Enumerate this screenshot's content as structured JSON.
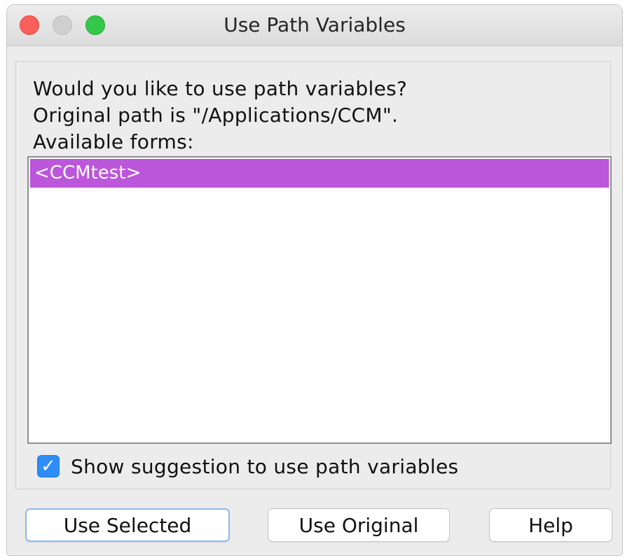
{
  "window": {
    "title": "Use Path Variables"
  },
  "message": {
    "line1": "Would you like to use path variables?",
    "line2": "Original path is \"/Applications/CCM\".",
    "line3": "Available forms:"
  },
  "forms_list": {
    "items": [
      {
        "label": "<CCMtest>",
        "selected": true
      }
    ]
  },
  "suggestion_checkbox": {
    "label": "Show suggestion to use path variables",
    "checked": true,
    "check_glyph": "✓"
  },
  "buttons": {
    "use_selected": "Use Selected",
    "use_original": "Use Original",
    "help": "Help"
  },
  "colors": {
    "selection": "#bc56db",
    "checkbox": "#2d8df8",
    "close": "#fc605c",
    "minimize": "#cfcfcf",
    "zoom": "#34c749"
  }
}
